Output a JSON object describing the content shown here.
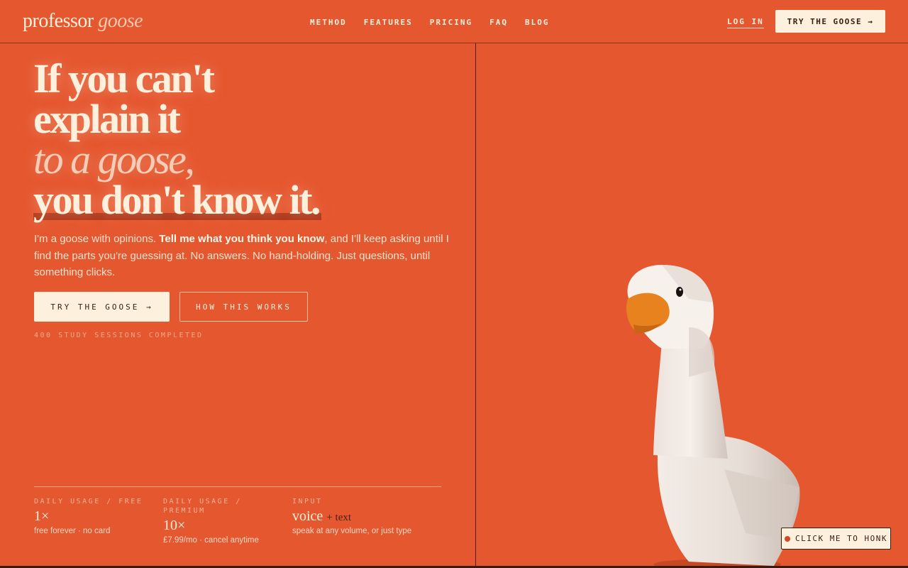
{
  "brand": {
    "name": "professor",
    "name_italic": "goose"
  },
  "nav": {
    "links": [
      "METHOD",
      "FEATURES",
      "PRICING",
      "FAQ",
      "BLOG"
    ],
    "login": "LOG IN",
    "cta": "TRY THE GOOSE →"
  },
  "hero": {
    "line1": "If you can't",
    "line2": "explain it",
    "line3": "to a goose,",
    "line4": "you don't know it.",
    "intro_pre": "I'm a goose with opinions. ",
    "intro_bold": "Tell me what you think you know",
    "intro_post": ", and I'll keep asking until I find the parts you're guessing at. No answers. No hand-holding. Just questions, until something clicks.",
    "primary_button": "TRY THE GOOSE →",
    "secondary_button": "HOW THIS WORKS",
    "sessions": "400 STUDY SESSIONS COMPLETED"
  },
  "stats": [
    {
      "label": "DAILY USAGE / FREE",
      "value": "1×",
      "value_extra": "",
      "note": "free forever · no card"
    },
    {
      "label": "DAILY USAGE / PREMIUM",
      "value": "10×",
      "value_extra": "",
      "note": "£7.99/mo · cancel anytime"
    },
    {
      "label": "INPUT",
      "value": "voice",
      "value_extra": "+ text",
      "note": "speak at any volume, or just type"
    }
  ],
  "honk_button": "CLICK ME TO HONK",
  "colors": {
    "background": "#e5572f",
    "cream": "#fdf1de",
    "dark": "#3a1b10",
    "beak": "#e8821f"
  }
}
